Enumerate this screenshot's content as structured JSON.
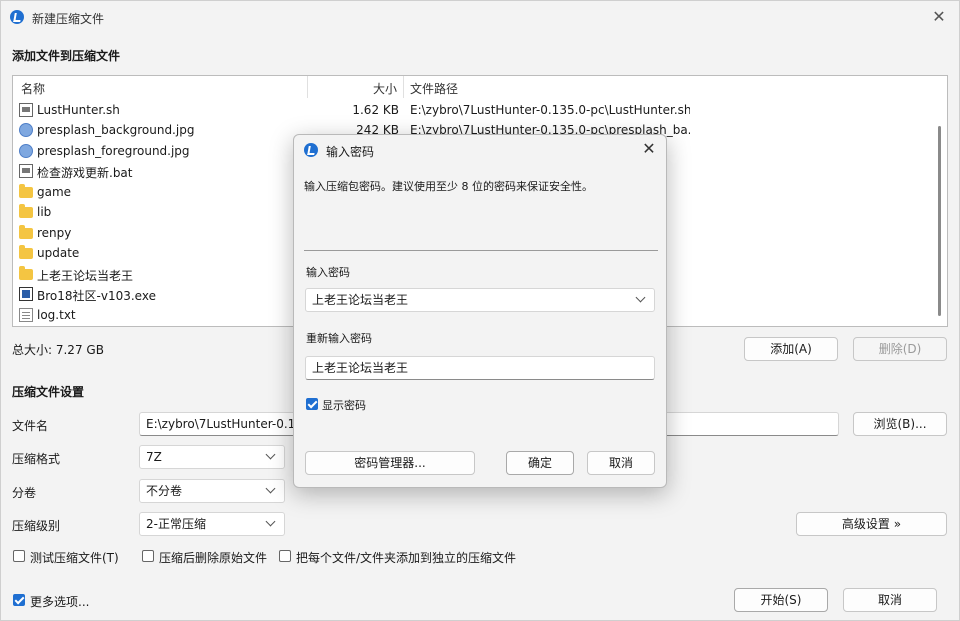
{
  "window": {
    "title": "新建压缩文件"
  },
  "files_section": {
    "title": "添加文件到压缩文件"
  },
  "file_list": {
    "columns": {
      "name": "名称",
      "size": "大小",
      "path": "文件路径"
    },
    "rows": [
      {
        "name": "LustHunter.sh",
        "size": "1.62 KB",
        "path": "E:\\zybro\\7LustHunter-0.135.0-pc\\LustHunter.sh",
        "icon": "file-icon"
      },
      {
        "name": "presplash_background.jpg",
        "size": "242 KB",
        "path": "E:\\zybro\\7LustHunter-0.135.0-pc\\presplash_ba...",
        "icon": "image-icon"
      },
      {
        "name": "presplash_foreground.jpg",
        "size": "",
        "path": "",
        "icon": "image-icon"
      },
      {
        "name": "检查游戏更新.bat",
        "size": "",
        "path": "",
        "icon": "file-icon"
      },
      {
        "name": "game",
        "size": "",
        "path": "",
        "icon": "folder-icon"
      },
      {
        "name": "lib",
        "size": "",
        "path": "",
        "icon": "folder-icon"
      },
      {
        "name": "renpy",
        "size": "",
        "path": "",
        "icon": "folder-icon"
      },
      {
        "name": "update",
        "size": "",
        "path": "",
        "icon": "folder-icon"
      },
      {
        "name": "上老王论坛当老王",
        "size": "",
        "path": "",
        "icon": "folder-icon"
      },
      {
        "name": "Bro18社区-v103.exe",
        "size": "",
        "path": "",
        "icon": "exe-icon"
      },
      {
        "name": "log.txt",
        "size": "",
        "path": "",
        "icon": "txt-icon"
      }
    ]
  },
  "total_size": "总大小: 7.27 GB",
  "buttons": {
    "add": "添加(A)",
    "delete": "删除(D)",
    "browse": "浏览(B)...",
    "advanced": "高级设置 »",
    "start": "开始(S)",
    "cancel": "取消"
  },
  "settings": {
    "title": "压缩文件设置",
    "filename_label": "文件名",
    "filename_value": "E:\\zybro\\7LustHunter-0.13",
    "format_label": "压缩格式",
    "format_value": "7Z",
    "volume_label": "分卷",
    "volume_value": "不分卷",
    "level_label": "压缩级别",
    "level_value": "2-正常压缩"
  },
  "options": {
    "test": {
      "label": "测试压缩文件(T)",
      "checked": false
    },
    "delete_source": {
      "label": "压缩后删除原始文件",
      "checked": false
    },
    "separate": {
      "label": "把每个文件/文件夹添加到独立的压缩文件",
      "checked": false
    },
    "more": {
      "label": "更多选项...",
      "checked": true
    }
  },
  "dialog": {
    "title": "输入密码",
    "description": "输入压缩包密码。建议使用至少 8 位的密码来保证安全性。",
    "password_label": "输入密码",
    "password_value": "上老王论坛当老王",
    "reenter_label": "重新输入密码",
    "reenter_value": "上老王论坛当老王",
    "show_password": {
      "label": "显示密码",
      "checked": true
    },
    "manager_button": "密码管理器...",
    "ok_button": "确定",
    "cancel_button": "取消"
  }
}
